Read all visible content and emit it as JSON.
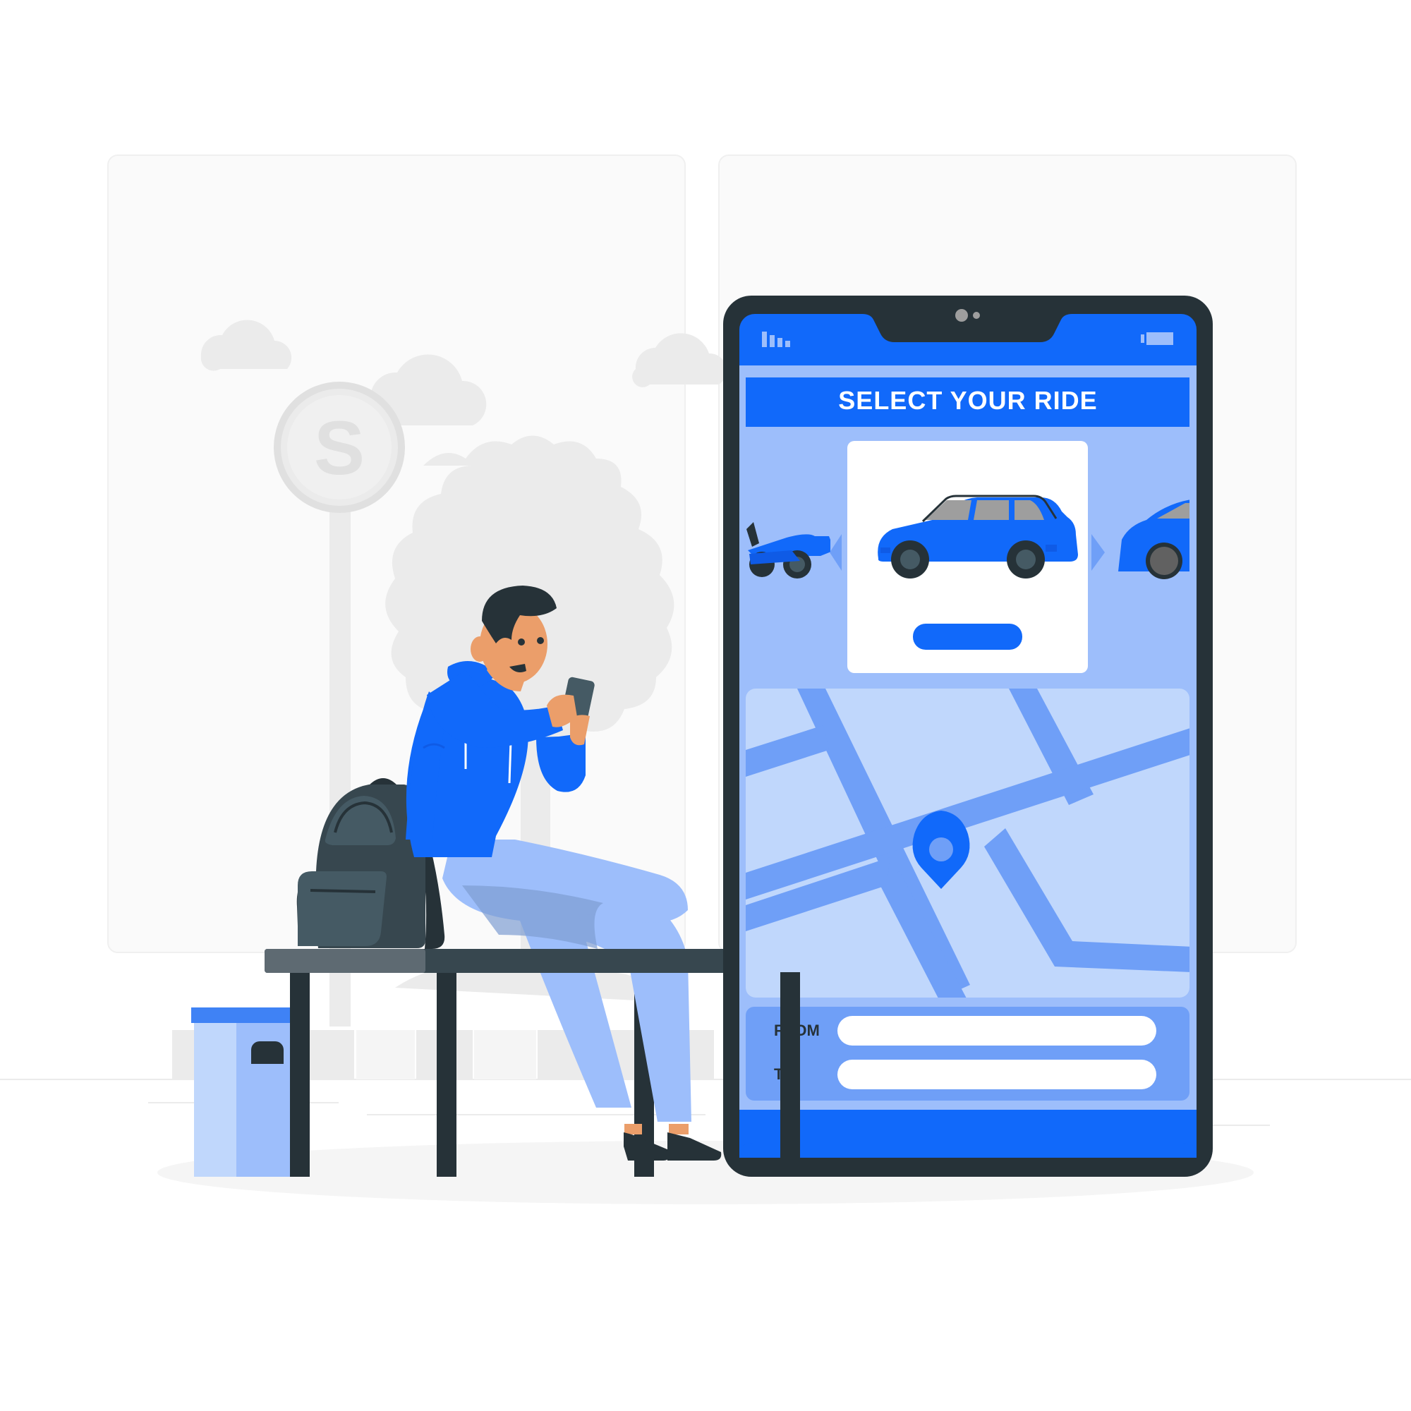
{
  "app": {
    "header_title": "SELECT YOUR RIDE",
    "from_label": "FROM",
    "to_label": "TO",
    "from_value": "",
    "to_value": ""
  },
  "bus_stop_sign": {
    "letter": "S"
  },
  "colors": {
    "primary": "#1169fa",
    "primary_dark": "#0f5be6",
    "light_blue": "#9dbefb",
    "pale_blue": "#c0d7fc",
    "road_blue": "#6f9ff7",
    "phone_frame": "#263238",
    "bench_dark": "#37474f",
    "backdrop_gray": "#ebebeb"
  },
  "icons": {
    "signal": "signal-bars-icon",
    "battery": "battery-icon",
    "prev": "chevron-left-icon",
    "next": "chevron-right-icon",
    "map_pin": "map-pin-icon"
  }
}
